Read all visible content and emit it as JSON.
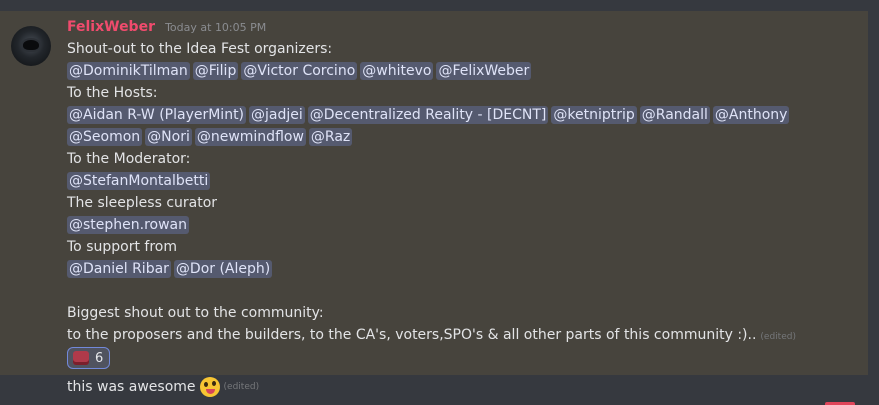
{
  "message": {
    "author": "FelixWeber",
    "timestamp": "Today at 10:05 PM",
    "lines": [
      {
        "type": "text",
        "text": "Shout-out to the Idea Fest organizers:"
      },
      {
        "type": "mentions",
        "items": [
          "@DominikTilman",
          "@Filip",
          "@Victor Corcino",
          "@whitevo",
          "@FelixWeber"
        ]
      },
      {
        "type": "text",
        "text": "To the Hosts:"
      },
      {
        "type": "mentions",
        "items": [
          "@Aidan R-W (PlayerMint)",
          "@jadjei",
          "@Decentralized Reality - [DECNT]",
          "@ketniptrip",
          "@Randall",
          "@Anthony"
        ]
      },
      {
        "type": "mentions",
        "items": [
          "@Seomon",
          "@Nori",
          "@newmindflow",
          "@Raz"
        ]
      },
      {
        "type": "text",
        "text": "To the Moderator:"
      },
      {
        "type": "mentions",
        "items": [
          "@StefanMontalbetti"
        ]
      },
      {
        "type": "text",
        "text": "The sleepless curator"
      },
      {
        "type": "mentions",
        "items": [
          "@stephen.rowan"
        ]
      },
      {
        "type": "text",
        "text": "To support  from"
      },
      {
        "type": "mentions",
        "items": [
          "@Daniel Ribar",
          "@Dor (Aleph)"
        ]
      },
      {
        "type": "text",
        "text": ""
      },
      {
        "type": "text",
        "text": "Biggest shout out to the community:"
      },
      {
        "type": "text",
        "text": "to the proposers and the builders, to the CA's, voters,SPO's & all other parts of this community :)..",
        "edited": "(edited)"
      }
    ],
    "reaction": {
      "emoji": "ticket-emoji",
      "count": "6"
    }
  },
  "followup": {
    "text": "this was awesome",
    "emoji": "zany-face-emoji",
    "edited": "(edited)"
  },
  "colors": {
    "background": "#36393f",
    "highlight": "#47443d",
    "author": "#f04b6d",
    "mention_bg": "rgba(114,137,218,0.32)"
  }
}
